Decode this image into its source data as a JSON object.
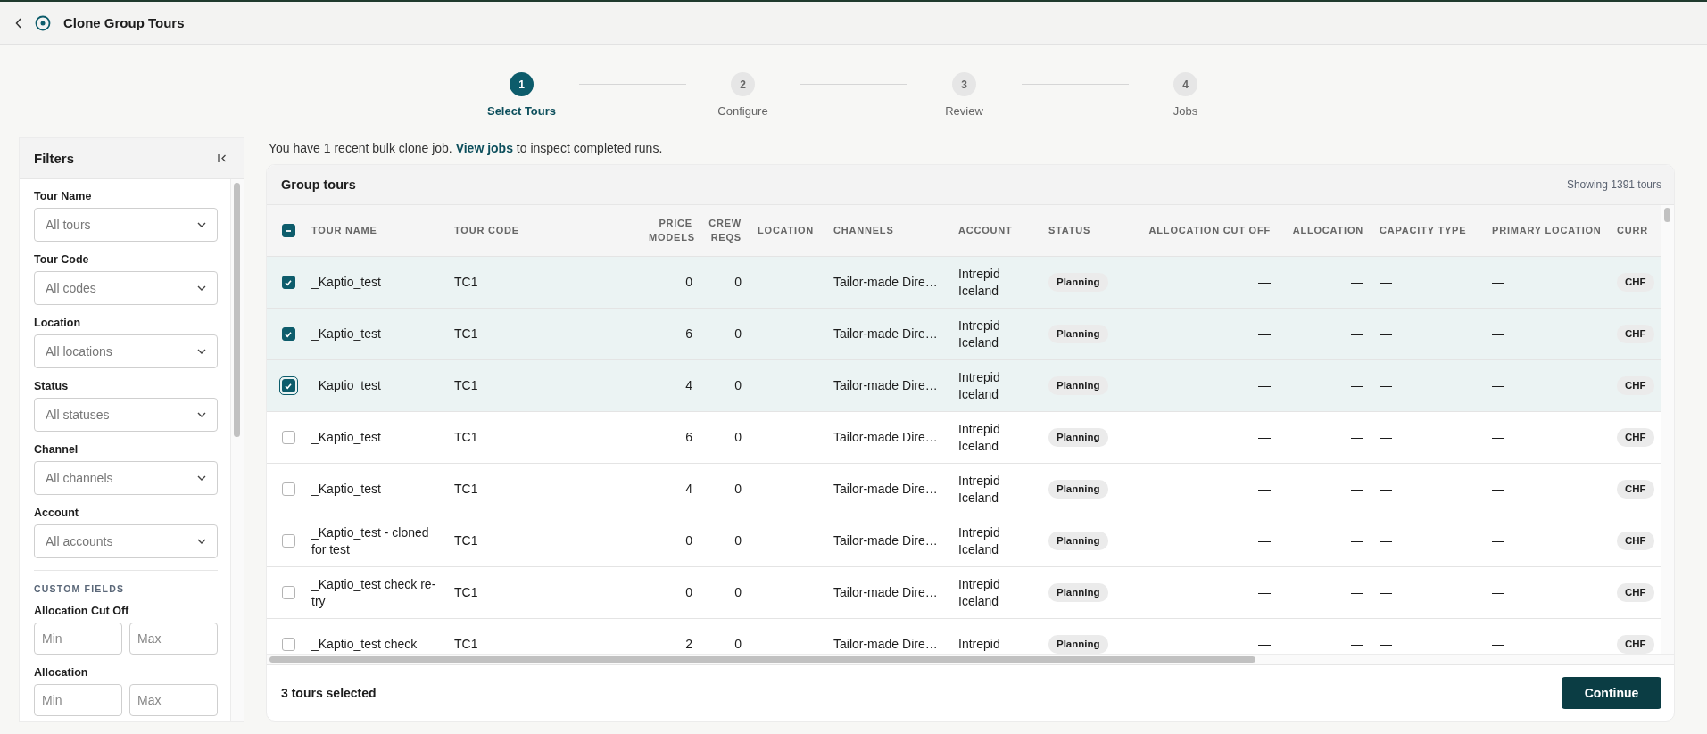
{
  "header": {
    "title": "Clone Group Tours"
  },
  "steps": [
    {
      "number": "1",
      "label": "Select Tours",
      "selected": true
    },
    {
      "number": "2",
      "label": "Configure",
      "selected": false
    },
    {
      "number": "3",
      "label": "Review",
      "selected": false
    },
    {
      "number": "4",
      "label": "Jobs",
      "selected": false
    }
  ],
  "notice": {
    "before": "You have 1 recent bulk clone job.",
    "link": "View jobs",
    "after": "to inspect completed runs."
  },
  "filters": {
    "title": "Filters",
    "dropdowns": [
      {
        "label": "Tour Name",
        "placeholder": "All tours"
      },
      {
        "label": "Tour Code",
        "placeholder": "All codes"
      },
      {
        "label": "Location",
        "placeholder": "All locations"
      },
      {
        "label": "Status",
        "placeholder": "All statuses"
      },
      {
        "label": "Channel",
        "placeholder": "All channels"
      },
      {
        "label": "Account",
        "placeholder": "All accounts"
      }
    ],
    "section_title": "CUSTOM FIELDS",
    "ranges": [
      {
        "label": "Allocation Cut Off",
        "min_placeholder": "Min",
        "max_placeholder": "Max"
      },
      {
        "label": "Allocation",
        "min_placeholder": "Min",
        "max_placeholder": "Max"
      }
    ]
  },
  "table": {
    "title": "Group tours",
    "count": "Showing 1391 tours",
    "header_checkbox": {
      "indeterminate": true
    },
    "columns": [
      {
        "label": "TOUR NAME",
        "kind": "text"
      },
      {
        "label": "TOUR CODE",
        "kind": "text"
      },
      {
        "label": "PRICE MODELS",
        "kind": "number"
      },
      {
        "label": "CREW REQS",
        "kind": "number"
      },
      {
        "label": "LOCATION",
        "kind": "text"
      },
      {
        "label": "CHANNELS",
        "kind": "text"
      },
      {
        "label": "ACCOUNT",
        "kind": "text"
      },
      {
        "label": "STATUS",
        "kind": "pill"
      },
      {
        "label": "ALLOCATION CUT OFF",
        "kind": "number"
      },
      {
        "label": "ALLOCATION",
        "kind": "number"
      },
      {
        "label": "CAPACITY TYPE",
        "kind": "text"
      },
      {
        "label": "PRIMARY LOCATION",
        "kind": "text"
      },
      {
        "label": "CURR",
        "kind": "pill"
      }
    ],
    "rows": [
      {
        "selected": true,
        "focused": false,
        "cells": [
          "_Kaptio_test",
          "TC1",
          "0",
          "0",
          null,
          "Tailor-made Dire…",
          "Intrepid Iceland",
          "Planning",
          "—",
          "—",
          "—",
          "—",
          "CHF"
        ]
      },
      {
        "selected": true,
        "focused": false,
        "cells": [
          "_Kaptio_test",
          "TC1",
          "6",
          "0",
          null,
          "Tailor-made Dire…",
          "Intrepid Iceland",
          "Planning",
          "—",
          "—",
          "—",
          "—",
          "CHF"
        ]
      },
      {
        "selected": true,
        "focused": true,
        "cells": [
          "_Kaptio_test",
          "TC1",
          "4",
          "0",
          null,
          "Tailor-made Dire…",
          "Intrepid Iceland",
          "Planning",
          "—",
          "—",
          "—",
          "—",
          "CHF"
        ]
      },
      {
        "selected": false,
        "focused": false,
        "cells": [
          "_Kaptio_test",
          "TC1",
          "6",
          "0",
          null,
          "Tailor-made Dire…",
          "Intrepid Iceland",
          "Planning",
          "—",
          "—",
          "—",
          "—",
          "CHF"
        ]
      },
      {
        "selected": false,
        "focused": false,
        "cells": [
          "_Kaptio_test",
          "TC1",
          "4",
          "0",
          null,
          "Tailor-made Dire…",
          "Intrepid Iceland",
          "Planning",
          "—",
          "—",
          "—",
          "—",
          "CHF"
        ]
      },
      {
        "selected": false,
        "focused": false,
        "cells": [
          "_Kaptio_test - cloned for test",
          "TC1",
          "0",
          "0",
          null,
          "Tailor-made Dire…",
          "Intrepid Iceland",
          "Planning",
          "—",
          "—",
          "—",
          "—",
          "CHF"
        ]
      },
      {
        "selected": false,
        "focused": false,
        "cells": [
          "_Kaptio_test check re-try",
          "TC1",
          "0",
          "0",
          null,
          "Tailor-made Dire…",
          "Intrepid Iceland",
          "Planning",
          "—",
          "—",
          "—",
          "—",
          "CHF"
        ]
      },
      {
        "selected": false,
        "focused": false,
        "cells": [
          "_Kaptio_test check",
          "TC1",
          "2",
          "0",
          null,
          "Tailor-made Dire…",
          "Intrepid",
          "Planning",
          "—",
          "—",
          "—",
          "—",
          "CHF"
        ]
      }
    ]
  },
  "footer": {
    "selected_text": "3 tours selected",
    "button": "Continue"
  }
}
